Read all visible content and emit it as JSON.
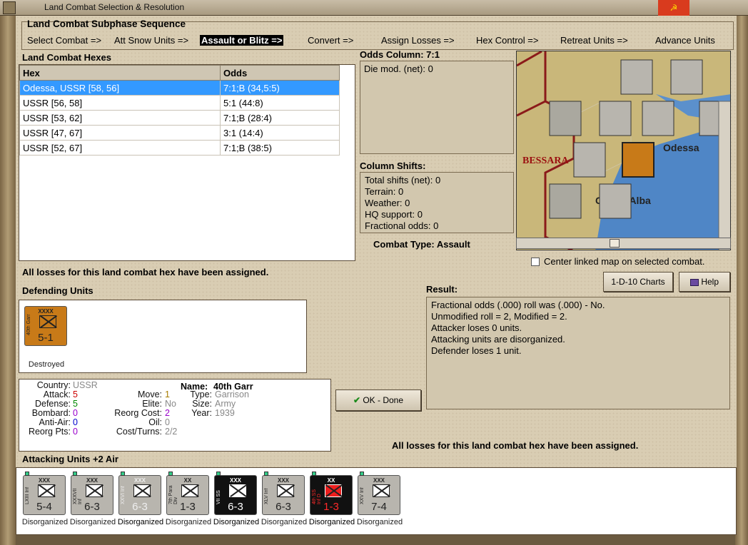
{
  "window": {
    "title": "Land Combat Selection & Resolution",
    "close_label": "☭"
  },
  "sequence": {
    "title": "Land Combat Subphase Sequence",
    "steps": [
      "Select Combat =>",
      "Att Snow Units =>",
      "Assault or Blitz =>",
      "Convert =>",
      "Assign Losses =>",
      "Hex Control =>",
      "Retreat Units =>",
      "Advance Units"
    ],
    "active_index": 2
  },
  "hexes": {
    "title": "Land Combat Hexes",
    "headers": [
      "Hex",
      "Odds"
    ],
    "rows": [
      {
        "hex": "Odessa, USSR [58, 56]",
        "odds": "7:1;B (34,5:5)"
      },
      {
        "hex": "USSR [56, 58]",
        "odds": "5:1 (44:8)"
      },
      {
        "hex": "USSR [53, 62]",
        "odds": "7:1;B (28:4)"
      },
      {
        "hex": "USSR [47, 67]",
        "odds": "3:1 (14:4)"
      },
      {
        "hex": "USSR [52, 67]",
        "odds": "7:1;B (38:5)"
      }
    ],
    "selected_index": 0
  },
  "odds": {
    "title": "Odds Column: 7:1",
    "die_mod": "Die mod. (net): 0"
  },
  "shifts": {
    "title": "Column Shifts:",
    "lines": [
      "Total shifts (net): 0",
      "Terrain: 0",
      "Weather: 0",
      "HQ support: 0",
      "Fractional odds: 0"
    ]
  },
  "combat_type": "Combat Type:  Assault",
  "map": {
    "labels": [
      "BESSARA",
      "Odessa",
      "C",
      "a-Alba"
    ],
    "center_label": "Center linked map on selected combat."
  },
  "losses_msg": "All losses for this land combat hex have been assigned.",
  "defending": {
    "title": "Defending Units",
    "unit": {
      "name": "40th Garr",
      "size": "XXXX",
      "value": "5-1",
      "status": "Destroyed"
    }
  },
  "info": {
    "labels": [
      "Country:",
      "Attack:",
      "Defense:",
      "Bombard:",
      "Anti-Air:",
      "Reorg Pts:"
    ],
    "values": [
      "USSR",
      "5",
      "5",
      "0",
      "0",
      "0"
    ],
    "mid_labels": [
      "Move:",
      "Elite:",
      "Reorg Cost:",
      "Oil:",
      "Cost/Turns:"
    ],
    "mid_values": [
      "1",
      "No",
      "2",
      "0",
      "2/2"
    ],
    "name_label": "Name:",
    "name": "40th Garr",
    "right_labels": [
      "Type:",
      "Size:",
      "Year:"
    ],
    "right_values": [
      "Garrison",
      "Army",
      "1939"
    ]
  },
  "buttons": {
    "charts": "1-D-10 Charts",
    "help": "Help",
    "ok": "OK - Done"
  },
  "result": {
    "title": "Result:",
    "lines": [
      "Fractional odds (.000) roll was (.000)  - No.",
      "Unmodified roll = 2, Modified = 2.",
      "Attacker loses 0 units.",
      "Attacking units are disorganized.",
      "Defender loses 1 unit."
    ]
  },
  "attacking": {
    "title": "Attacking Units +2 Air",
    "units": [
      {
        "name": "LXIII Inf",
        "size": "XXX",
        "value": "5-4",
        "status": "Disorganized",
        "style": "gray"
      },
      {
        "name": "XXXVII Inf",
        "size": "XXX",
        "value": "6-3",
        "status": "Disorganized",
        "style": "gray"
      },
      {
        "name": "XXVI Inf",
        "size": "XXX",
        "value": "6-3",
        "status": "Disorganized",
        "style": "gray"
      },
      {
        "name": "7th Para Div",
        "size": "XX",
        "value": "1-3",
        "status": "Disorganized",
        "style": "gray"
      },
      {
        "name": "VII SS",
        "size": "XXX",
        "value": "6-3",
        "status": "Disorganized",
        "style": "black"
      },
      {
        "name": "XLV Inf",
        "size": "XXX",
        "value": "6-3",
        "status": "Disorganized",
        "style": "gray"
      },
      {
        "name": "4th SS Inf D",
        "size": "XX",
        "value": "1-3",
        "status": "Disorganized",
        "style": "red"
      },
      {
        "name": "XXV Inf",
        "size": "XXX",
        "value": "7-4",
        "status": "Disorganized",
        "style": "gray"
      }
    ]
  }
}
